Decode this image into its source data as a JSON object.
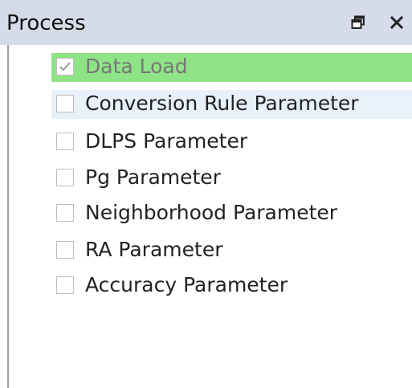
{
  "panel": {
    "title": "Process",
    "float_icon": "float-window-icon",
    "close_icon": "close-icon"
  },
  "colors": {
    "titlebar": "#d6dbe9",
    "selected_row": "#8fe387",
    "hover_row": "#e8f0fa"
  },
  "items": [
    {
      "label": "Data Load",
      "checked": true,
      "state": "selected-disabled"
    },
    {
      "label": "Conversion Rule Parameter",
      "checked": false,
      "state": "hover"
    },
    {
      "label": "DLPS Parameter",
      "checked": false,
      "state": "normal"
    },
    {
      "label": "Pg Parameter",
      "checked": false,
      "state": "normal"
    },
    {
      "label": "Neighborhood Parameter",
      "checked": false,
      "state": "normal"
    },
    {
      "label": "RA Parameter",
      "checked": false,
      "state": "normal"
    },
    {
      "label": "Accuracy Parameter",
      "checked": false,
      "state": "normal"
    }
  ]
}
